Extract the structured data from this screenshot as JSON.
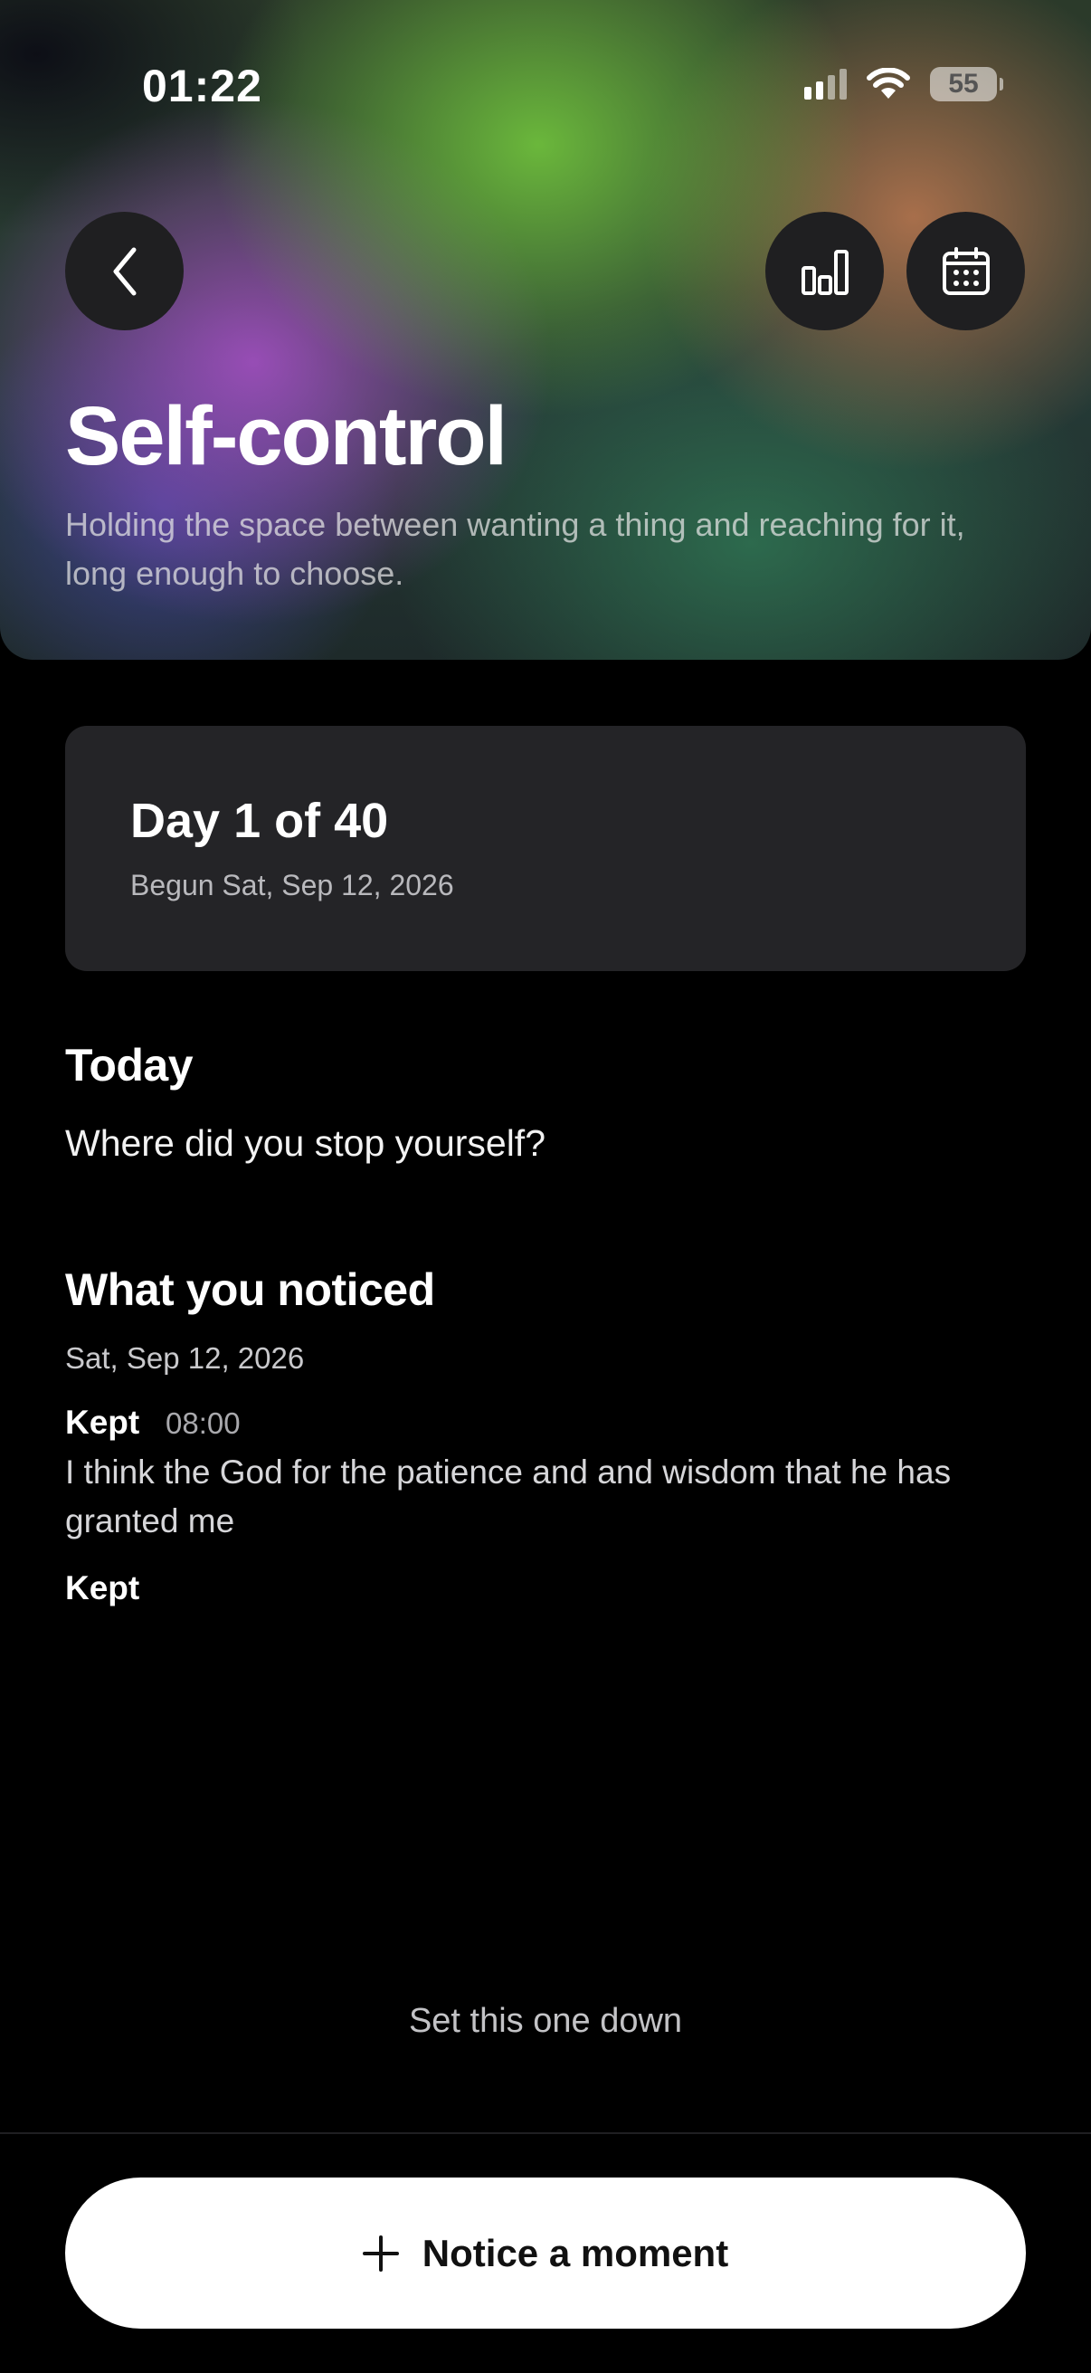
{
  "status_bar": {
    "time": "01:22",
    "battery": "55",
    "icons": [
      "cellular-signal-icon",
      "wifi-icon",
      "battery-icon"
    ]
  },
  "header": {
    "back_icon": "chevron-left-icon",
    "stats_icon": "bar-chart-icon",
    "calendar_icon": "calendar-icon",
    "title": "Self-control",
    "subtitle": "Holding the space between wanting a thing and reaching for it, long enough to choose."
  },
  "progress": {
    "title": "Day 1 of 40",
    "current_day": 1,
    "total_days": 40,
    "begun": "Begun Sat, Sep 12, 2026"
  },
  "today": {
    "heading": "Today",
    "prompt": "Where did you stop yourself?"
  },
  "noticed": {
    "heading": "What you noticed",
    "date": "Sat, Sep 12, 2026",
    "entries": [
      {
        "label": "Kept",
        "time": "08:00",
        "text": "I think the God for the patience and and wisdom that he has granted me"
      },
      {
        "label": "Kept"
      }
    ]
  },
  "actions": {
    "set_down": "Set this one down",
    "primary": "Notice a moment",
    "primary_icon": "plus-icon"
  },
  "colors": {
    "background": "#000000",
    "card": "#242427",
    "button": "#ffffff",
    "icon_button": "#1f1f21"
  }
}
